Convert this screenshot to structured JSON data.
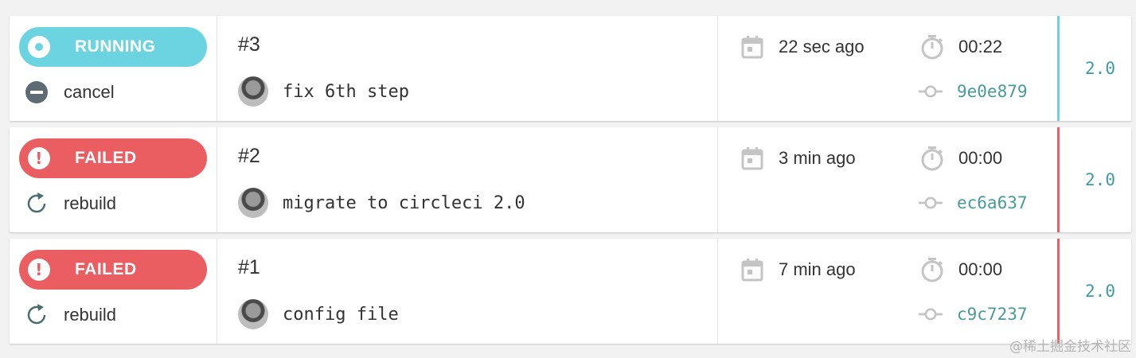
{
  "colors": {
    "running": "#6cd4e0",
    "failed": "#ea5e62",
    "hash_text": "#4a9a9a",
    "version_text": "#3f9aa7",
    "icon_gray": "#c4c4c4",
    "cancel_icon": "#5d6b72",
    "rebuild_icon": "#4a6e6e"
  },
  "builds": [
    {
      "status": "RUNNING",
      "status_type": "running",
      "status_icon": "running-dot-icon",
      "action_label": "cancel",
      "action_icon": "cancel-icon",
      "number": "#3",
      "commit_message": "fix 6th step",
      "time_ago": "22 sec ago",
      "duration": "00:22",
      "commit_hash": "9e0e879",
      "version": "2.0"
    },
    {
      "status": "FAILED",
      "status_type": "failed",
      "status_icon": "exclamation-icon",
      "action_label": "rebuild",
      "action_icon": "rebuild-icon",
      "number": "#2",
      "commit_message": "migrate to circleci 2.0",
      "time_ago": "3 min ago",
      "duration": "00:00",
      "commit_hash": "ec6a637",
      "version": "2.0"
    },
    {
      "status": "FAILED",
      "status_type": "failed",
      "status_icon": "exclamation-icon",
      "action_label": "rebuild",
      "action_icon": "rebuild-icon",
      "number": "#1",
      "commit_message": "config file",
      "time_ago": "7 min ago",
      "duration": "00:00",
      "commit_hash": "c9c7237",
      "version": "2.0"
    }
  ],
  "watermark": "@稀土掘金技术社区"
}
